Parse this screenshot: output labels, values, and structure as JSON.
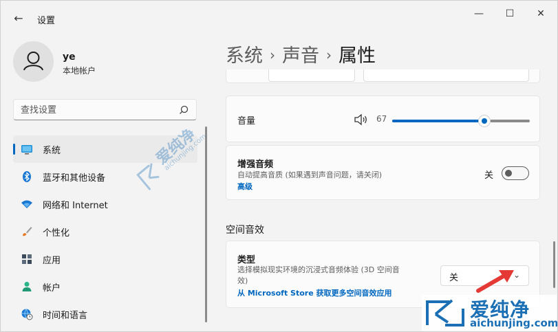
{
  "window": {
    "title": "设置",
    "back_glyph": "←",
    "minimize_glyph": "—",
    "maximize_glyph": "☐",
    "close_glyph": "✕"
  },
  "user": {
    "name": "ye",
    "account_type": "本地帐户"
  },
  "search": {
    "placeholder": "查找设置",
    "value": ""
  },
  "sidebar": {
    "items": [
      {
        "label": "系统",
        "icon": "system-icon",
        "active": true
      },
      {
        "label": "蓝牙和其他设备",
        "icon": "bluetooth-icon",
        "active": false
      },
      {
        "label": "网络和 Internet",
        "icon": "wifi-icon",
        "active": false
      },
      {
        "label": "个性化",
        "icon": "brush-icon",
        "active": false
      },
      {
        "label": "应用",
        "icon": "apps-icon",
        "active": false
      },
      {
        "label": "帐户",
        "icon": "account-icon",
        "active": false
      },
      {
        "label": "时间和语言",
        "icon": "globe-clock-icon",
        "active": false
      }
    ]
  },
  "breadcrumb": {
    "level1": "系统",
    "level2": "声音",
    "current": "属性",
    "separator": "›"
  },
  "volume": {
    "label": "音量",
    "value": "67",
    "level_percent": 67,
    "icon": "speaker-icon"
  },
  "enhance_audio": {
    "title": "增强音频",
    "description": "自动提高音质 (如果遇到声音问题，请关闭)",
    "link": "高级",
    "toggle_label": "关",
    "toggle_on": false
  },
  "spatial_audio": {
    "section_title": "空间音效",
    "title": "类型",
    "description_line1": "选择模拟现实环境的沉浸式音频体验 (3D 空间音",
    "description_line2": "效)",
    "link": "从 Microsoft Store 获取更多空间音效应用",
    "dropdown_value": "关",
    "dropdown_chevron": "⌄"
  },
  "watermark": {
    "title": "爱纯净",
    "url": "aichunjing.com",
    "faint_text": "爱纯净",
    "faint_url": "aichunjing.com"
  },
  "colors": {
    "accent": "#0067c0",
    "annotation_arrow": "#e53935",
    "watermark": "#1a6fb5"
  }
}
